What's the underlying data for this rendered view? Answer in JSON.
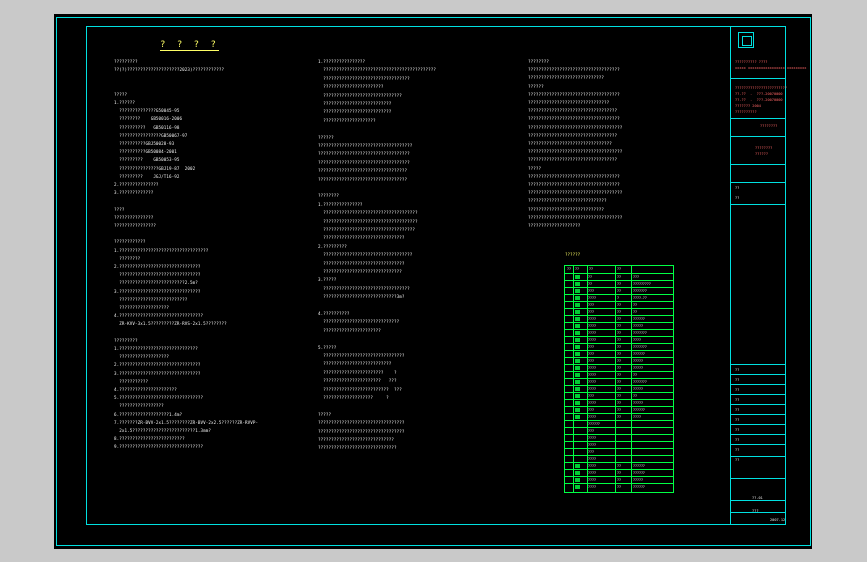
{
  "drawing": {
    "title": "? ? ? ?",
    "table_title": "??????"
  },
  "col1": [
    "?????????",
    "??(?)????????????????????2023)????????????",
    "",
    "",
    "?????",
    "1.??????",
    "  ??????????????G50045-95",
    "  ????????    GB50016-2006",
    "  ??????????   GB50116-98",
    "  ????????????????GB50067-97",
    "  ??????????GBJ50028-93",
    "  ??????????GB50084-2001",
    "  ?????????    GB50053-95",
    "  ???????????????GBJ19-87  2002",
    "  ?????????    JGJ/T16-92",
    "2.???????????????",
    "3.?????????????",
    "",
    "????",
    "???????????????",
    "????????????????",
    "",
    "????????????",
    "1.??????????????????????????????????",
    "  ????????",
    "2.???????????????????????????????",
    "  ???????????????????????????????",
    "  ?????????????????????????2.5m?",
    "3.???????????????????????????????",
    "  ??????????????????????????",
    "  ???????????????????",
    "4.????????????????????????????????",
    "  ZR-KVV-3x1.5?????????ZR-RVS-2x1.5????????",
    "",
    "?????????",
    "1.??????????????????????????????",
    "  ???????????????????",
    "2.???????????????????????????????",
    "3.???????????????????????????????",
    "  ???????????",
    "4.??????????????????????",
    "5.????????????????????????????????",
    "  ?????????????????",
    "6.???????????????????1.4m?",
    "7.???????ZR-BVV-2x1.5????????ZR-BVV-2x2.5??????ZR-RVVP-",
    "  2x1.5????????????????????????1.3mm?",
    "8.?????????????????????????",
    "9.????????????????????????????????"
  ],
  "col2": [
    "1.????????????????",
    "  ???????????????????????????????????????????",
    "  ?????????????????????????????????",
    "  ???????????????????????",
    "  ??????????????????????????????",
    "  ??????????????????????????",
    "  ??????????????????????????",
    "  ????????????????????",
    "",
    "??????",
    "????????????????????????????????????",
    "???????????????????????????????????",
    "???????????????????????????????????",
    "??????????????????????????????????",
    "??????????????????????????????????",
    "",
    "????????",
    "1.???????????????",
    "  ????????????????????????????????????",
    "  ????????????????????????????????????",
    "  ???????????????????????????????????",
    "  ???????????????????????????????",
    "2.?????????",
    "  ??????????????????????????????????",
    "  ???????????????????????????????",
    "  ??????????????????????????????",
    "3.?????",
    "  ?????????????????????????????????",
    "  ????????????????????????????3m?",
    "",
    "4.??????????",
    "  ?????????????????????????????",
    "  ??????????????????????",
    "",
    "5.?????",
    "  ???????????????????????????????",
    "  ??????????????????????????",
    "  ???????????????????????    ?",
    "  ??????????????????????   ???",
    "  ?????????????????????????  ???",
    "  ???????????????????     ?",
    "",
    "?????",
    "?????????????????????????????????",
    "?????????????????????????????????",
    "?????????????????????????????",
    "??????????????????????????????"
  ],
  "col3": [
    "????????",
    "???????????????????????????????????",
    "?????????????????????????????",
    "??????",
    "???????????????????????????????????",
    "???????????????????????????????",
    "??????????????????????????????????",
    "???????????????????????????????????",
    "????????????????????????????????????",
    "??????????????????????????????????",
    "????????????????????????????????",
    "????????????????????????????????????",
    "??????????????????????????????????",
    "?????",
    "???????????????????????????????????",
    "???????????????????????????????????",
    "????????????????????????????????????",
    "??????????????????????????????",
    "?????????????????????????????",
    "????????????????????????????????????",
    "????????????????????"
  ],
  "table": {
    "headers": [
      "??",
      "??",
      "??",
      "??"
    ],
    "rows": [
      [
        "??",
        "??",
        "???"
      ],
      [
        "??",
        "??",
        "?????????"
      ],
      [
        "???",
        "??",
        "???????"
      ],
      [
        "????",
        "?",
        "????-??"
      ],
      [
        "???",
        "??",
        "??"
      ],
      [
        "???",
        "??",
        "??"
      ],
      [
        "????",
        "??",
        "??????"
      ],
      [
        "????",
        "??",
        "?????"
      ],
      [
        "????",
        "??",
        "???????"
      ],
      [
        "????",
        "??",
        "????"
      ],
      [
        "???",
        "??",
        "???????"
      ],
      [
        "???",
        "??",
        "??????"
      ],
      [
        "???",
        "??",
        "?????"
      ],
      [
        "????",
        "??",
        "?????"
      ],
      [
        "????",
        "??",
        "??"
      ],
      [
        "????",
        "??",
        "???????"
      ],
      [
        "????",
        "??",
        "?????"
      ],
      [
        "???",
        "??",
        "??"
      ],
      [
        "????",
        "??",
        "?????"
      ],
      [
        "???",
        "??",
        "??????"
      ],
      [
        "????",
        "??",
        "????"
      ],
      [
        "??????",
        "",
        ""
      ],
      [
        "???",
        "",
        ""
      ],
      [
        "????",
        "",
        ""
      ],
      [
        "????",
        "",
        ""
      ],
      [
        "???",
        "",
        ""
      ],
      [
        "????",
        "",
        ""
      ],
      [
        "????",
        "??",
        "??????"
      ],
      [
        "????",
        "??",
        "??????"
      ],
      [
        "????",
        "??",
        "?????"
      ],
      [
        "????",
        "??",
        "??????"
      ]
    ]
  },
  "title_block": {
    "company": "?????????? ????",
    "company_en": "xxxxx xxxxxxxxxxxxxxxxx xxxxxxxxx",
    "cert_lines": [
      "????????????????????????",
      "??-??  -  ???-20070000",
      "??-??  -  ???-20070000",
      "??????? 2004",
      "??????????"
    ],
    "project": "????????",
    "drawing_name": "????????",
    "drawing_sub": "??????",
    "rows": [
      "??",
      "??",
      "??",
      "??",
      "??",
      "??",
      "??",
      "??",
      "??",
      "??",
      "??",
      "??"
    ],
    "sheet_no": "??-01",
    "scale": "???",
    "date": "2007.12"
  }
}
